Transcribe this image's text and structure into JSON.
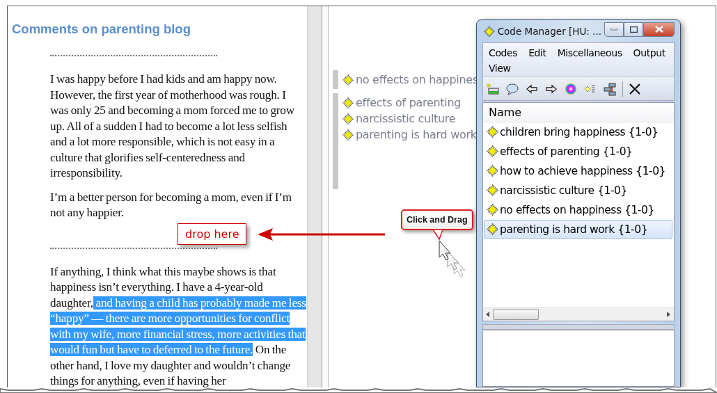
{
  "document": {
    "title": "Comments on parenting blog",
    "blocks": [
      {
        "kind": "separator"
      },
      {
        "kind": "paragraph",
        "text": "I was happy before I had kids and am happy now. However, the first year of motherhood was rough. I was only 25 and becoming a mom forced me to grow up. All of a sudden I had to become a lot less selfish and a lot more responsible, which is not easy in a culture that glorifies self-centeredness and irresponsibility."
      },
      {
        "kind": "paragraph",
        "text": "I’m a better person for becoming a mom, even if I’m not any happier."
      },
      {
        "kind": "separator"
      },
      {
        "kind": "paragraph",
        "text": "If anything, I think what this maybe shows is that happiness isn’t everything. I have a 4-year-old daughter,",
        "selected_text": " and having a child has probably made me less “happy” — there are more opportunities for conflict with my wife, more financial stress, more activities that would fun but have to deferred to the future.",
        "after": " On the other hand, I love my daughter and wouldn’t change things for anything, even if having her"
      }
    ]
  },
  "margin": {
    "groups": [
      {
        "codes": [
          "no effects on happines"
        ]
      },
      {
        "codes": [
          "effects of parenting",
          "narcissistic culture",
          "parenting is hard work"
        ]
      }
    ]
  },
  "annotations": [
    {
      "kind": "box",
      "text": "drop here"
    },
    {
      "kind": "bubble",
      "text": "Click and Drag"
    }
  ],
  "code_manager": {
    "title": "Code Manager [HU: ...",
    "menu": [
      "Codes",
      "Edit",
      "Miscellaneous",
      "Output",
      "View"
    ],
    "column": "Name",
    "codes": [
      {
        "label": "children bring happiness {1-0}",
        "selected": false
      },
      {
        "label": "effects of parenting {1-0}",
        "selected": false
      },
      {
        "label": "how to achieve happiness {1-0}",
        "selected": false
      },
      {
        "label": "narcissistic culture {1-0}",
        "selected": false
      },
      {
        "label": "no effects on happiness {1-0}",
        "selected": false
      },
      {
        "label": "parenting is hard work {1-0}",
        "selected": true
      }
    ]
  }
}
